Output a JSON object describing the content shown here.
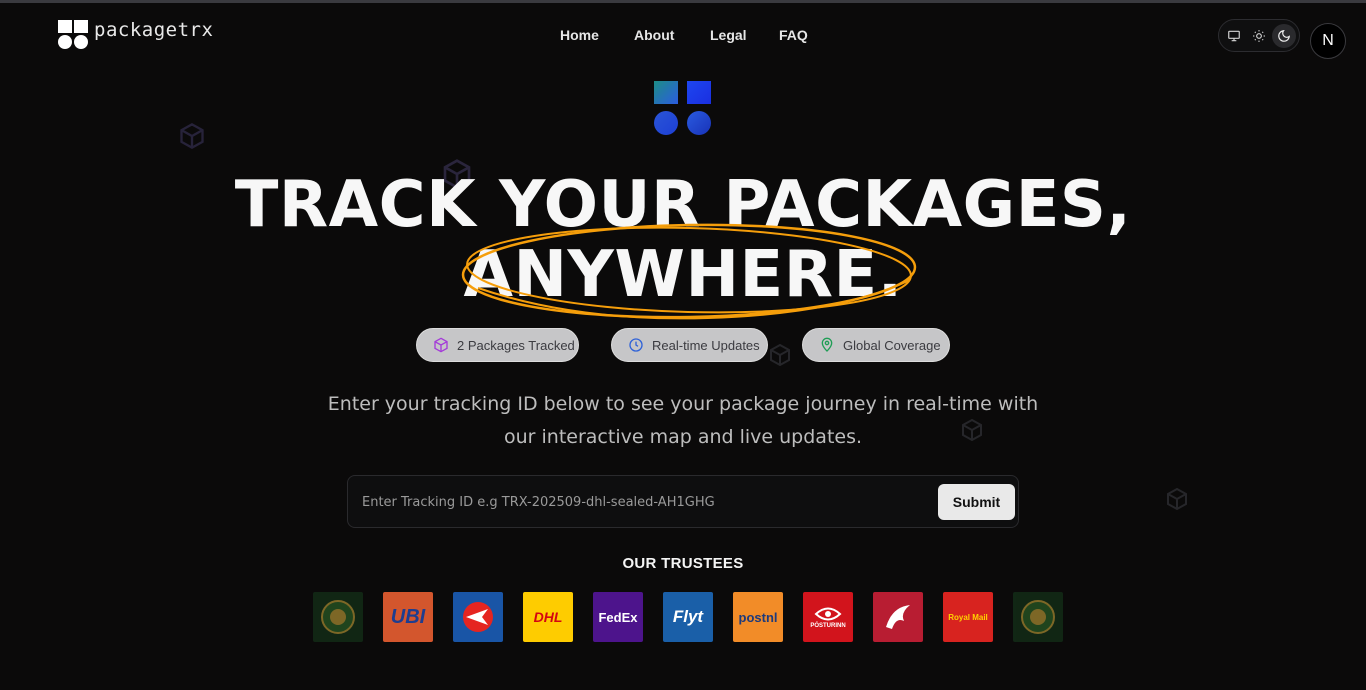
{
  "app": {
    "brand": "packagetrx"
  },
  "nav": {
    "items": [
      "Home",
      "About",
      "Legal",
      "FAQ"
    ]
  },
  "header": {
    "avatar_letter": "N",
    "theme_modes": [
      "system",
      "light",
      "dark"
    ],
    "active_theme": "dark"
  },
  "hero": {
    "title_line1": "TRACK YOUR PACKAGES,",
    "title_line2": "ANYWHERE.",
    "pills": [
      {
        "label": "2 Packages Tracked",
        "icon": "package-icon",
        "color": "#a43ad9"
      },
      {
        "label": "Real-time Updates",
        "icon": "clock-icon",
        "color": "#2f62d8"
      },
      {
        "label": "Global Coverage",
        "icon": "map-pin-icon",
        "color": "#1f9d55"
      }
    ],
    "subtitle_line1": "Enter your tracking ID below to see your package journey in real-time with",
    "subtitle_line2": "our interactive map and live updates."
  },
  "search": {
    "placeholder": "Enter Tracking ID e.g TRX-202509-dhl-sealed-AH1GHG",
    "value": "",
    "submit_label": "Submit"
  },
  "trustees": {
    "title": "OUR TRUSTEES",
    "logos": [
      {
        "name": "emblem-logo",
        "text": ""
      },
      {
        "name": "ubi-logo",
        "text": "UBI"
      },
      {
        "name": "canada-post-logo",
        "text": ""
      },
      {
        "name": "dhl-logo",
        "text": "DHL"
      },
      {
        "name": "fedex-logo",
        "text": "FedEx"
      },
      {
        "name": "flyt-logo",
        "text": "Flyt"
      },
      {
        "name": "postnl-logo",
        "text": "postnl"
      },
      {
        "name": "posturinn-logo",
        "text": "PÓSTURINN"
      },
      {
        "name": "pegasus-logo",
        "text": ""
      },
      {
        "name": "royal-mail-logo",
        "text": "Royal Mail"
      },
      {
        "name": "emblem-logo-2",
        "text": ""
      }
    ]
  },
  "colors": {
    "background": "#0b0a0a",
    "accent_scribble": "#f59e0b"
  }
}
